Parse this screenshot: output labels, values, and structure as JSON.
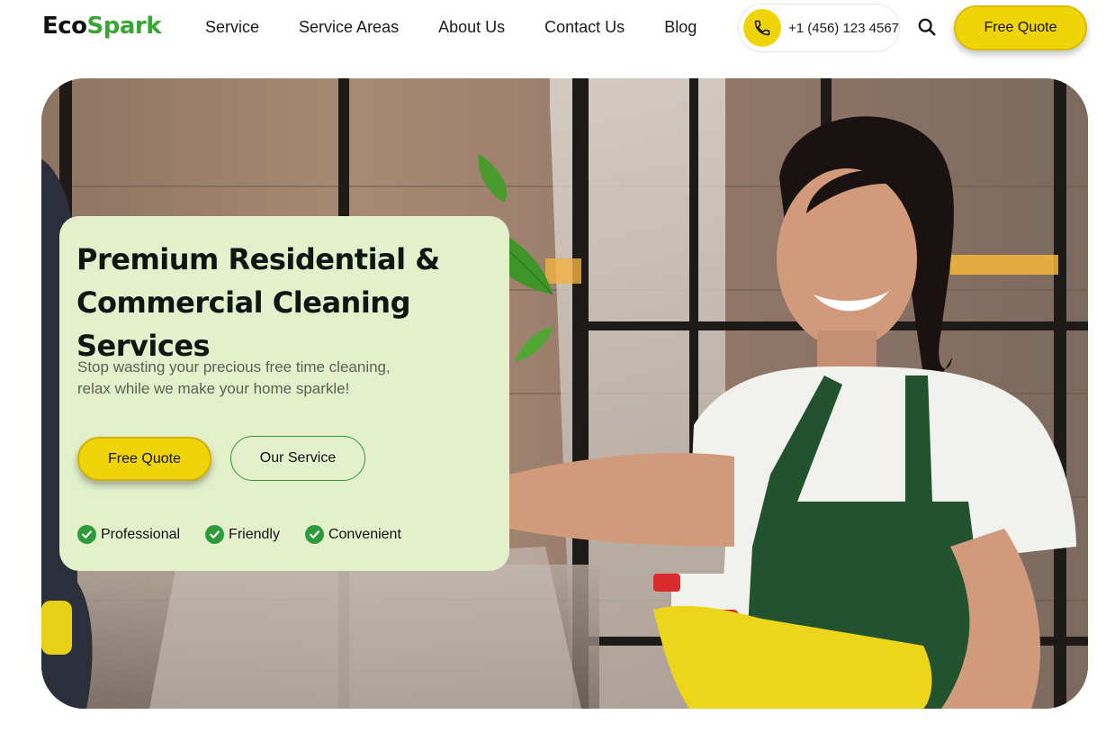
{
  "brand": {
    "part1": "Eco",
    "part2": "Spark"
  },
  "nav": {
    "items": [
      {
        "label": "Service"
      },
      {
        "label": "Service Areas"
      },
      {
        "label": "About Us"
      },
      {
        "label": "Contact Us"
      },
      {
        "label": "Blog"
      }
    ]
  },
  "header": {
    "phone": "+1 (456) 123 4567",
    "quote_label": "Free Quote",
    "icons": {
      "phone": "phone-icon",
      "search": "search-icon"
    }
  },
  "hero": {
    "title_line1": "Premium Residential &",
    "title_line2": "Commercial Cleaning Services",
    "subtitle_line1": "Stop wasting your precious free time cleaning,",
    "subtitle_line2": "relax while we make your home sparkle!",
    "primary_cta": "Free Quote",
    "secondary_cta": "Our Service",
    "features": [
      {
        "label": "Professional"
      },
      {
        "label": "Friendly"
      },
      {
        "label": "Convenient"
      }
    ]
  },
  "colors": {
    "accent_yellow": "#f0d40a",
    "brand_green": "#3aa537",
    "card_bg": "#e3f0cb",
    "check_green": "#2e9b3a"
  }
}
